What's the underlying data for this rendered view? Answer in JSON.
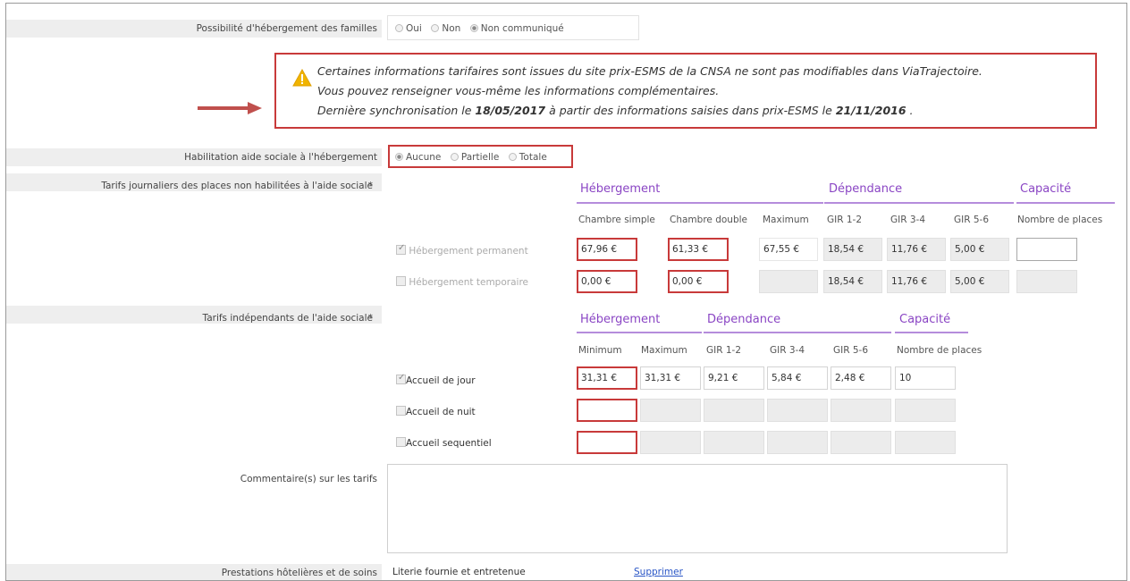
{
  "hebergement_familles": {
    "label": "Possibilité d'hébergement des familles",
    "options": [
      "Oui",
      "Non",
      "Non communiqué"
    ],
    "selected": "Non communiqué"
  },
  "notice": {
    "line1": "Certaines informations tarifaires sont issues du site prix-ESMS de la CNSA ne sont pas modifiables dans ViaTrajectoire.",
    "line2": "Vous pouvez renseigner vous-même les informations complémentaires.",
    "line3_a": "Dernière synchronisation le ",
    "sync_date": "18/05/2017",
    "line3_b": " à partir des informations saisies dans prix-ESMS le ",
    "esms_date": "21/11/2016",
    "line3_c": " ."
  },
  "habilitation": {
    "label": "Habilitation aide sociale à l'hébergement",
    "options": [
      "Aucune",
      "Partielle",
      "Totale"
    ],
    "selected": "Aucune"
  },
  "tarifs_non_habilitees": {
    "label": "Tarifs journaliers des places non habilitées à l'aide sociale",
    "required": "*",
    "sections": [
      "Hébergement",
      "Dépendance",
      "Capacité"
    ],
    "columns": [
      "Chambre simple",
      "Chambre double",
      "Maximum",
      "GIR 1-2",
      "GIR 3-4",
      "GIR 5-6",
      "Nombre de places"
    ],
    "rows": [
      {
        "label": "Hébergement permanent",
        "checked": true,
        "values": [
          "67,96 €",
          "61,33 €",
          "67,55 €",
          "18,54 €",
          "11,76 €",
          "5,00 €",
          ""
        ]
      },
      {
        "label": "Hébergement temporaire",
        "checked": false,
        "values": [
          "0,00 €",
          "0,00 €",
          "",
          "18,54 €",
          "11,76 €",
          "5,00 €",
          ""
        ]
      }
    ]
  },
  "tarifs_independants": {
    "label": "Tarifs indépendants de l'aide sociale",
    "required": "*",
    "sections": [
      "Hébergement",
      "Dépendance",
      "Capacité"
    ],
    "columns": [
      "Minimum",
      "Maximum",
      "GIR 1-2",
      "GIR 3-4",
      "GIR 5-6",
      "Nombre de places"
    ],
    "rows": [
      {
        "label": "Accueil de jour",
        "checked": true,
        "values": [
          "31,31 €",
          "31,31 €",
          "9,21 €",
          "5,84 €",
          "2,48 €",
          "10"
        ]
      },
      {
        "label": "Accueil de nuit",
        "checked": false,
        "values": [
          "",
          "",
          "",
          "",
          "",
          ""
        ]
      },
      {
        "label": "Accueil sequentiel",
        "checked": false,
        "values": [
          "",
          "",
          "",
          "",
          "",
          ""
        ]
      }
    ]
  },
  "commentaires": {
    "label": "Commentaire(s) sur les tarifs",
    "value": ""
  },
  "prestations": {
    "label": "Prestations hôtelières et de soins",
    "item": "Literie fournie et entretenue",
    "action": "Supprimer"
  },
  "colors": {
    "accent": "#8a45c4",
    "error_border": "#c83a3a",
    "link": "#2a56c6",
    "warning": "#f0b400",
    "arrow": "#c0504d"
  }
}
